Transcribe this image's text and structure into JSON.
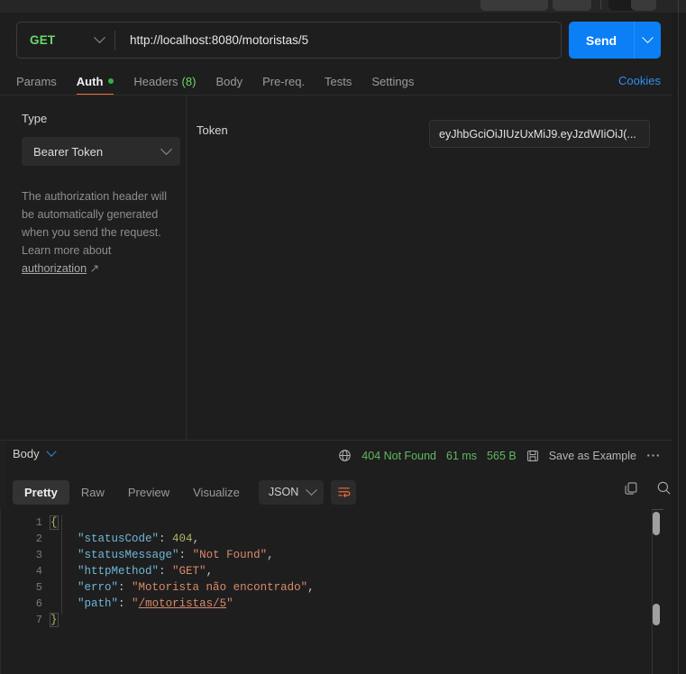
{
  "request": {
    "method": "GET",
    "url": "http://localhost:8080/motoristas/5",
    "send_label": "Send",
    "tabs": [
      {
        "label": "Params",
        "active": false,
        "dot": false,
        "count": ""
      },
      {
        "label": "Auth",
        "active": true,
        "dot": true,
        "count": ""
      },
      {
        "label": "Headers",
        "active": false,
        "dot": false,
        "count": "(8)"
      },
      {
        "label": "Body",
        "active": false,
        "dot": false,
        "count": ""
      },
      {
        "label": "Pre-req.",
        "active": false,
        "dot": false,
        "count": ""
      },
      {
        "label": "Tests",
        "active": false,
        "dot": false,
        "count": ""
      },
      {
        "label": "Settings",
        "active": false,
        "dot": false,
        "count": ""
      }
    ],
    "cookies_label": "Cookies"
  },
  "auth": {
    "type_label": "Type",
    "type_value": "Bearer Token",
    "help_text": "The authorization header will be automatically generated when you send the request. Learn more about ",
    "help_link": "authorization",
    "token_label": "Token",
    "token_value": "eyJhbGciOiJIUzUxMiJ9.eyJzdWIiOiJ(..."
  },
  "response": {
    "body_label": "Body",
    "status": "404 Not Found",
    "time": "61 ms",
    "size": "565 B",
    "save_example": "Save as Example",
    "tabs": [
      {
        "label": "Pretty",
        "active": true
      },
      {
        "label": "Raw",
        "active": false
      },
      {
        "label": "Preview",
        "active": false
      },
      {
        "label": "Visualize",
        "active": false
      }
    ],
    "format": "JSON",
    "code_lines": [
      {
        "num": "1",
        "segments": [
          {
            "t": "{",
            "c": "brace"
          }
        ]
      },
      {
        "num": "2",
        "segments": [
          {
            "t": "    ",
            "c": "p"
          },
          {
            "t": "\"statusCode\"",
            "c": "k"
          },
          {
            "t": ": ",
            "c": "p"
          },
          {
            "t": "404",
            "c": "n"
          },
          {
            "t": ",",
            "c": "p"
          }
        ]
      },
      {
        "num": "3",
        "segments": [
          {
            "t": "    ",
            "c": "p"
          },
          {
            "t": "\"statusMessage\"",
            "c": "k"
          },
          {
            "t": ": ",
            "c": "p"
          },
          {
            "t": "\"Not Found\"",
            "c": "s"
          },
          {
            "t": ",",
            "c": "p"
          }
        ]
      },
      {
        "num": "4",
        "segments": [
          {
            "t": "    ",
            "c": "p"
          },
          {
            "t": "\"httpMethod\"",
            "c": "k"
          },
          {
            "t": ": ",
            "c": "p"
          },
          {
            "t": "\"GET\"",
            "c": "s"
          },
          {
            "t": ",",
            "c": "p"
          }
        ]
      },
      {
        "num": "5",
        "segments": [
          {
            "t": "    ",
            "c": "p"
          },
          {
            "t": "\"erro\"",
            "c": "k"
          },
          {
            "t": ": ",
            "c": "p"
          },
          {
            "t": "\"Motorista não encontrado\"",
            "c": "s"
          },
          {
            "t": ",",
            "c": "p"
          }
        ]
      },
      {
        "num": "6",
        "segments": [
          {
            "t": "    ",
            "c": "p"
          },
          {
            "t": "\"path\"",
            "c": "k"
          },
          {
            "t": ": ",
            "c": "p"
          },
          {
            "t": "\"",
            "c": "s"
          },
          {
            "t": "/motoristas/5",
            "c": "pathstr"
          },
          {
            "t": "\"",
            "c": "s"
          }
        ]
      },
      {
        "num": "7",
        "segments": [
          {
            "t": "}",
            "c": "brace"
          }
        ]
      }
    ]
  },
  "colors": {
    "accent_blue": "#0b7ff5",
    "accent_orange": "#ef6c3a",
    "status_green": "#5fb95f",
    "method_green": "#6bd968",
    "link_blue": "#2f8ef4"
  }
}
